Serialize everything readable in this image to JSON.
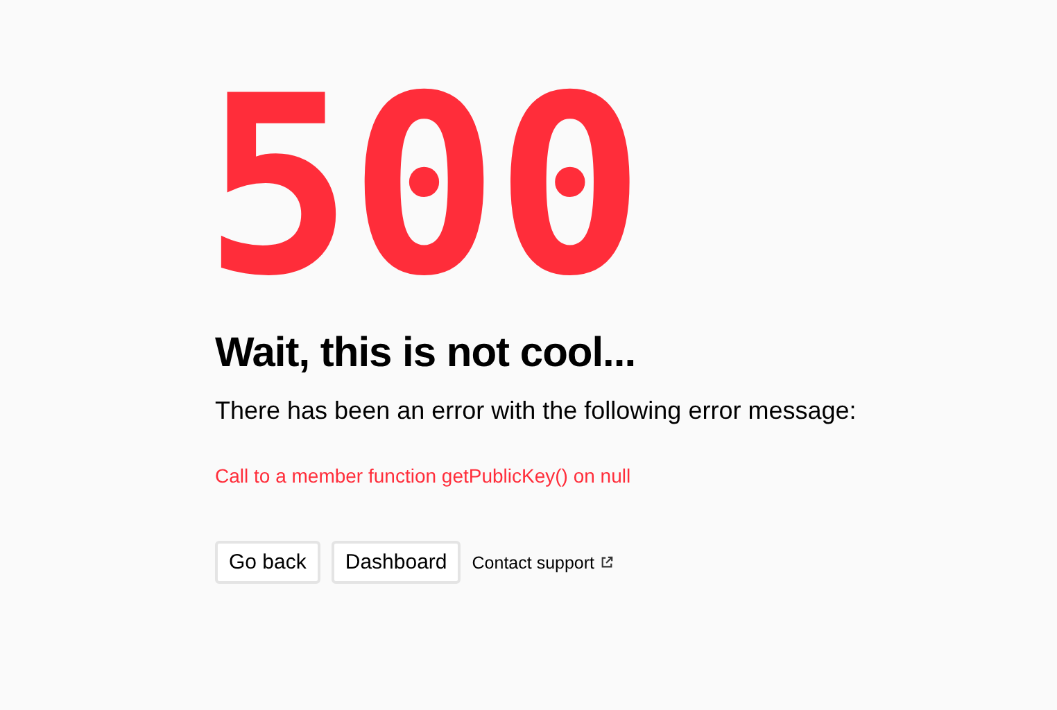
{
  "code": "500",
  "title": "Wait, this is not cool...",
  "message": "There has been an error with the following error message:",
  "error": "Call to a member function getPublicKey() on null",
  "buttons": [
    "Go back",
    "Dashboard"
  ],
  "link": {
    "label": "Contact support"
  }
}
